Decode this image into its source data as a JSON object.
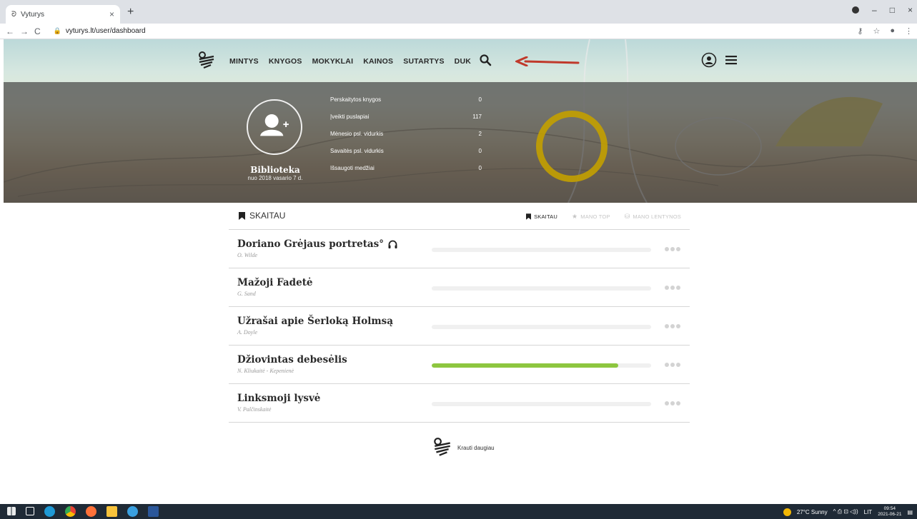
{
  "browser": {
    "tab_title": "Vyturys",
    "tab_close": "×",
    "new_tab": "+",
    "url": "vyturys.lt/user/dashboard",
    "back": "←",
    "forward": "→",
    "reload": "C",
    "lock": "🔒",
    "key": "⚷",
    "star": "☆",
    "menu": "⋮",
    "min": "–",
    "max": "□",
    "close": "×"
  },
  "nav": {
    "items": [
      "MINTYS",
      "KNYGOS",
      "MOKYKLAI",
      "KAINOS",
      "SUTARTYS",
      "DUK"
    ]
  },
  "profile": {
    "name": "Biblioteka",
    "since": "nuo 2018 vasario 7 d."
  },
  "stats": [
    {
      "label": "Perskaitytos knygos",
      "value": "0"
    },
    {
      "label": "Įveikti puslapiai",
      "value": "117"
    },
    {
      "label": "Mėnesio psl. vidurkis",
      "value": "2"
    },
    {
      "label": "Savaitės psl. vidurkis",
      "value": "0"
    },
    {
      "label": "Išsaugoti medžiai",
      "value": "0"
    }
  ],
  "list": {
    "title": "SKAITAU",
    "tabs": [
      "SKAITAU",
      "MANO TOP",
      "MANO LENTYNOS"
    ],
    "tab_icons": [
      "",
      "★",
      "⛁"
    ]
  },
  "books": [
    {
      "title": "Doriano Grėjaus portretas°",
      "author": "O. Wilde",
      "progress": 0,
      "audio": true
    },
    {
      "title": "Mažoji Fadetė",
      "author": "G. Sand",
      "progress": 0,
      "audio": false
    },
    {
      "title": "Užrašai apie Šerloką Holmsą",
      "author": "A. Doyle",
      "progress": 0,
      "audio": false
    },
    {
      "title": "Džiovintas debesėlis",
      "author": "N. Kliukaitė - Kepenienė",
      "progress": 0.85,
      "audio": false
    },
    {
      "title": "Linksmoji lysvė",
      "author": "V. Palčinskaitė",
      "progress": 0,
      "audio": false
    }
  ],
  "load_more": "Krauti daugiau",
  "taskbar": {
    "weather": "27°C Sunny",
    "tray_icons": "^  ⎙  ⊡  ◁))",
    "lang": "LIT",
    "time": "09:54",
    "date": "2021-06-21",
    "notify": "▤"
  },
  "colors": {
    "progress": "#8dc63f",
    "ring": "#c3a000",
    "arrow": "#c0392b"
  }
}
